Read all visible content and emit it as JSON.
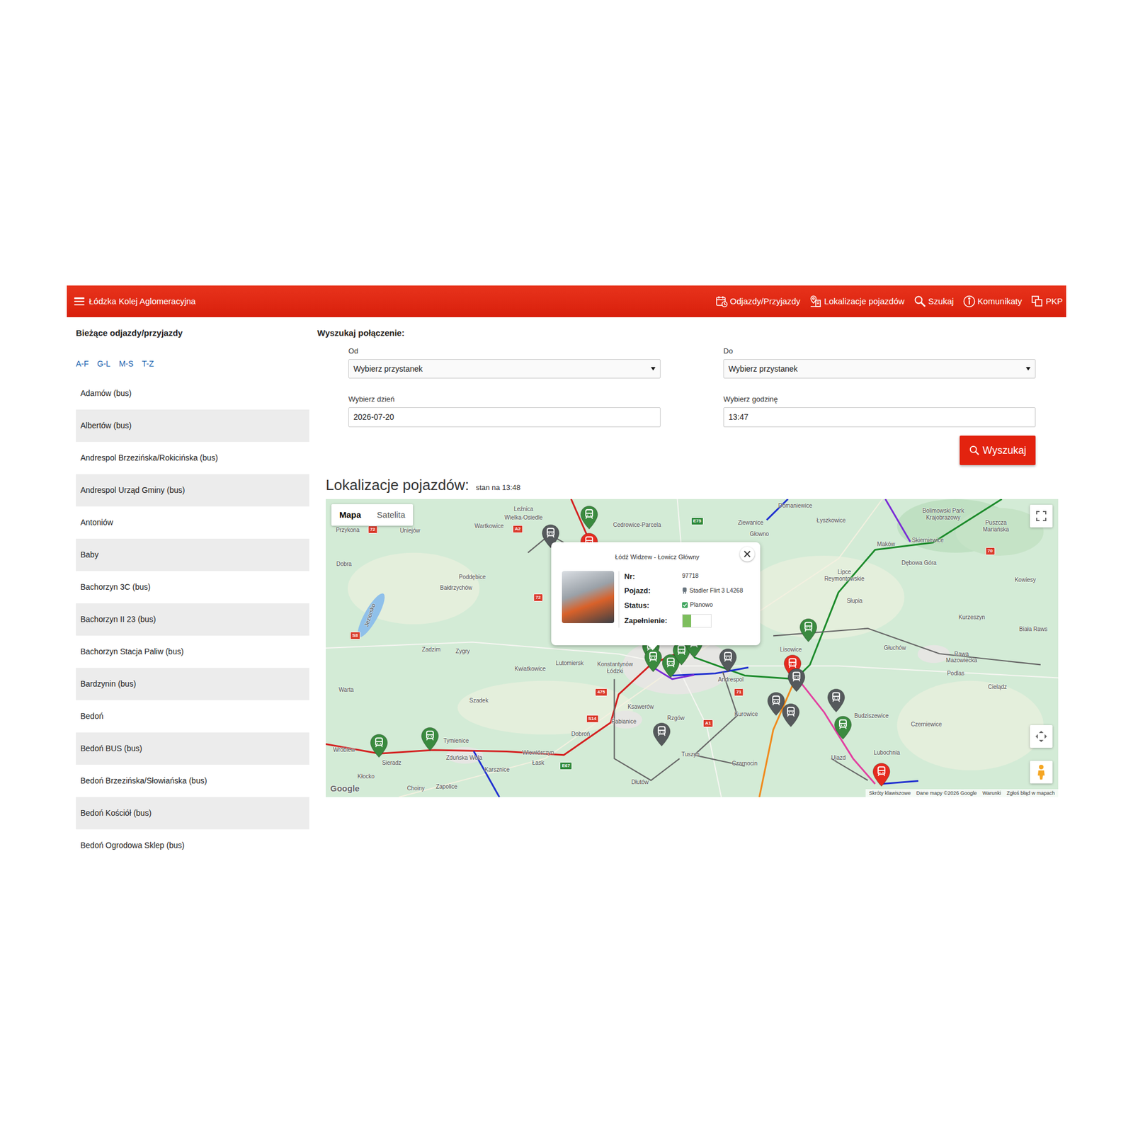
{
  "navbar": {
    "brand": "Łódzka Kolej Aglomeracyjna",
    "items": [
      {
        "label": "Odjazdy/Przyjazdy"
      },
      {
        "label": "Lokalizacje pojazdów"
      },
      {
        "label": "Szukaj"
      },
      {
        "label": "Komunikaty"
      },
      {
        "label": "PKP"
      }
    ]
  },
  "sidebar": {
    "title": "Bieżące odjazdy/przyjazdy",
    "letters": [
      {
        "label": "A-F"
      },
      {
        "label": "G-L"
      },
      {
        "label": "M-S"
      },
      {
        "label": "T-Z"
      }
    ],
    "stops": [
      {
        "label": "Adamów (bus)"
      },
      {
        "label": "Albertów (bus)"
      },
      {
        "label": "Andrespol Brzezińska/Rokicińska (bus)"
      },
      {
        "label": "Andrespol Urząd Gminy (bus)"
      },
      {
        "label": "Antoniów"
      },
      {
        "label": "Baby"
      },
      {
        "label": "Bachorzyn 3C (bus)"
      },
      {
        "label": "Bachorzyn II 23 (bus)"
      },
      {
        "label": "Bachorzyn Stacja Paliw (bus)"
      },
      {
        "label": "Bardzynin (bus)"
      },
      {
        "label": "Bedoń"
      },
      {
        "label": "Bedoń BUS (bus)"
      },
      {
        "label": "Bedoń Brzezińska/Słowiańska (bus)"
      },
      {
        "label": "Bedoń Kościół (bus)"
      },
      {
        "label": "Bedoń Ogrodowa Sklep (bus)"
      }
    ]
  },
  "search": {
    "title": "Wyszukaj połączenie:",
    "from": {
      "label": "Od",
      "value": "Wybierz przystanek"
    },
    "to": {
      "label": "Do",
      "value": "Wybierz przystanek"
    },
    "date": {
      "label": "Wybierz dzień",
      "value": "2026-07-20"
    },
    "time": {
      "label": "Wybierz godzinę",
      "value": "13:47"
    },
    "button": "Wyszukaj"
  },
  "map": {
    "title": "Lokalizacje pojazdów:",
    "timestamp": "stan na 13:48",
    "tabs": [
      {
        "label": "Mapa",
        "selected": true
      },
      {
        "label": "Satelita",
        "selected": false
      }
    ],
    "labels": [
      "Przykona",
      "Uniejów",
      "Wartkowice",
      "Leźnica",
      "Wielka-Osiedle",
      "Cedrowice-Parcela",
      "Domaniewice",
      "Łyszkowice",
      "Bolimowski Park Krajobrazowy",
      "Puszcza Mariańska",
      "Ziewanice",
      "Głowno",
      "Dobra",
      "Poddębice",
      "Bałdrzychów",
      "Jeziorsko",
      "Maków",
      "Skierniewice",
      "Dębowa Góra",
      "Lipce Reymontowskie",
      "Słupia",
      "Kowiesy",
      "Kurzeszyn",
      "Biała Raws",
      "Głuchów",
      "Rawa Mazowiecka",
      "Podlas",
      "Cielądz",
      "Lisowice",
      "Andrespol",
      "Kurowice",
      "Budziszewice",
      "Czerniewice",
      "Lubochnia",
      "Ujazd",
      "Tuszyn",
      "Czarnocin",
      "Rzgów",
      "Dłutów",
      "Ksawerów",
      "Pabianice",
      "Dobroń",
      "Łask",
      "Wiewiórczyn",
      "Karsznice",
      "Zduńska Wola",
      "Tymienice",
      "Sieradz",
      "Wróblew",
      "Kłocko",
      "Choiny",
      "Zapolice",
      "Warta",
      "Szadek",
      "Zadzim",
      "Zygry",
      "Kwiatkowice",
      "Lutomiersk",
      "Konstantynów Łódzki"
    ],
    "shields": [
      {
        "label": "72",
        "color": "#d93b2b"
      },
      {
        "label": "A2",
        "color": "#d93b2b"
      },
      {
        "label": "E75",
        "color": "#2f8a3c"
      },
      {
        "label": "72",
        "color": "#d93b2b"
      },
      {
        "label": "S8",
        "color": "#d93b2b"
      },
      {
        "label": "475",
        "color": "#d93b2b"
      },
      {
        "label": "S14",
        "color": "#d93b2b"
      },
      {
        "label": "A1",
        "color": "#d93b2b"
      },
      {
        "label": "E67",
        "color": "#2f8a3c"
      },
      {
        "label": "71",
        "color": "#d93b2b"
      },
      {
        "label": "70",
        "color": "#d93b2b"
      }
    ],
    "lines": [
      {
        "color": "#d42020"
      },
      {
        "color": "#d42020"
      },
      {
        "color": "#1b8a2a"
      },
      {
        "color": "#2030d0"
      },
      {
        "color": "#2030d0"
      },
      {
        "color": "#2030d0"
      },
      {
        "color": "#2030d0"
      },
      {
        "color": "#7a2bd6"
      },
      {
        "color": "#7a2bd6"
      },
      {
        "color": "#e23fa0"
      },
      {
        "color": "#f08a1c"
      },
      {
        "color": "#666666"
      },
      {
        "color": "#666666"
      },
      {
        "color": "#666666"
      },
      {
        "color": "#666666"
      },
      {
        "color": "#666666"
      }
    ],
    "pins": [
      {
        "color": "#3a8a3f"
      },
      {
        "color": "#55595c"
      },
      {
        "color": "#e52b1f"
      },
      {
        "color": "#3a8a3f"
      },
      {
        "color": "#3a8a3f"
      },
      {
        "color": "#3a8a3f"
      },
      {
        "color": "#3a8a3f"
      },
      {
        "color": "#3a8a3f"
      },
      {
        "color": "#55595c"
      },
      {
        "color": "#3a8a3f"
      },
      {
        "color": "#e52b1f"
      },
      {
        "color": "#55595c"
      },
      {
        "color": "#55595c"
      },
      {
        "color": "#55595c"
      },
      {
        "color": "#55595c"
      },
      {
        "color": "#3a8a3f"
      },
      {
        "color": "#55595c"
      },
      {
        "color": "#3a8a3f"
      },
      {
        "color": "#3a8a3f"
      },
      {
        "color": "#e52b1f"
      }
    ],
    "popup": {
      "route": "Łódź Widzew - Łowicz Główny",
      "fields": [
        {
          "label": "Nr:",
          "kind": "text",
          "value": "97718"
        },
        {
          "label": "Pojazd:",
          "kind": "vehicle",
          "value": "Stadler Flirt 3 L4268"
        },
        {
          "label": "Status:",
          "kind": "status",
          "value": "Planowo"
        },
        {
          "label": "Zapełnienie:",
          "kind": "meter",
          "level": 0.3
        }
      ]
    },
    "footer": {
      "logo": "Google",
      "links": [
        "Skróty klawiszowe",
        "Dane mapy ©2026 Google",
        "Warunki",
        "Zgłoś błąd w mapach"
      ]
    }
  }
}
